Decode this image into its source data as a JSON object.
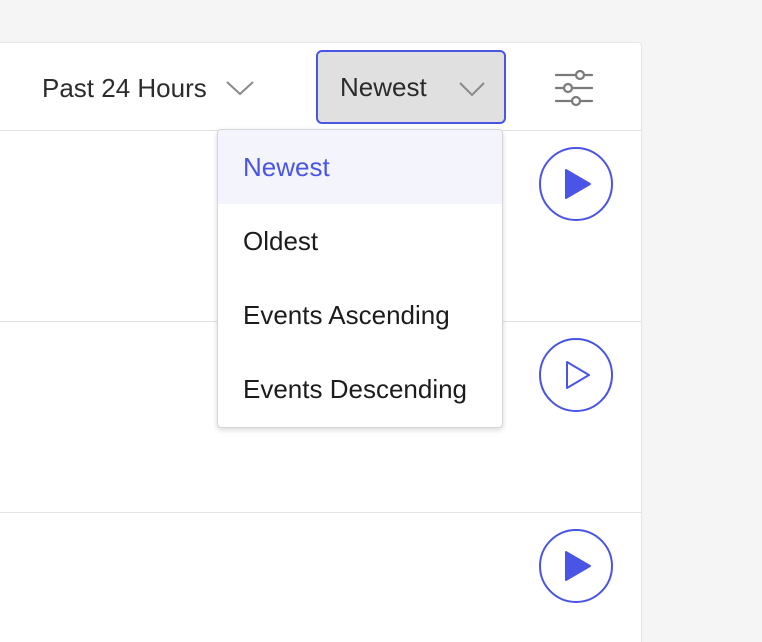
{
  "colors": {
    "accent": "#4a55e6",
    "panel_bg": "#ffffff",
    "page_bg": "#f5f5f5",
    "select_bg": "#e0e0e0",
    "active_option_bg": "#f4f4fc"
  },
  "toolbar": {
    "time_range": "Past 24 Hours",
    "sort_selected": "Newest",
    "time_range_icon": "chevron-down-icon",
    "sort_icon": "chevron-down-icon",
    "filters_icon": "sliders-icon"
  },
  "sort_dropdown": {
    "options": [
      {
        "label": "Newest",
        "active": true
      },
      {
        "label": "Oldest",
        "active": false
      },
      {
        "label": "Events Ascending",
        "active": false
      },
      {
        "label": "Events Descending",
        "active": false
      }
    ]
  },
  "rows": [
    {
      "play_icon": "play-filled-icon"
    },
    {
      "play_icon": "play-outline-icon"
    },
    {
      "play_icon": "play-filled-icon"
    }
  ]
}
